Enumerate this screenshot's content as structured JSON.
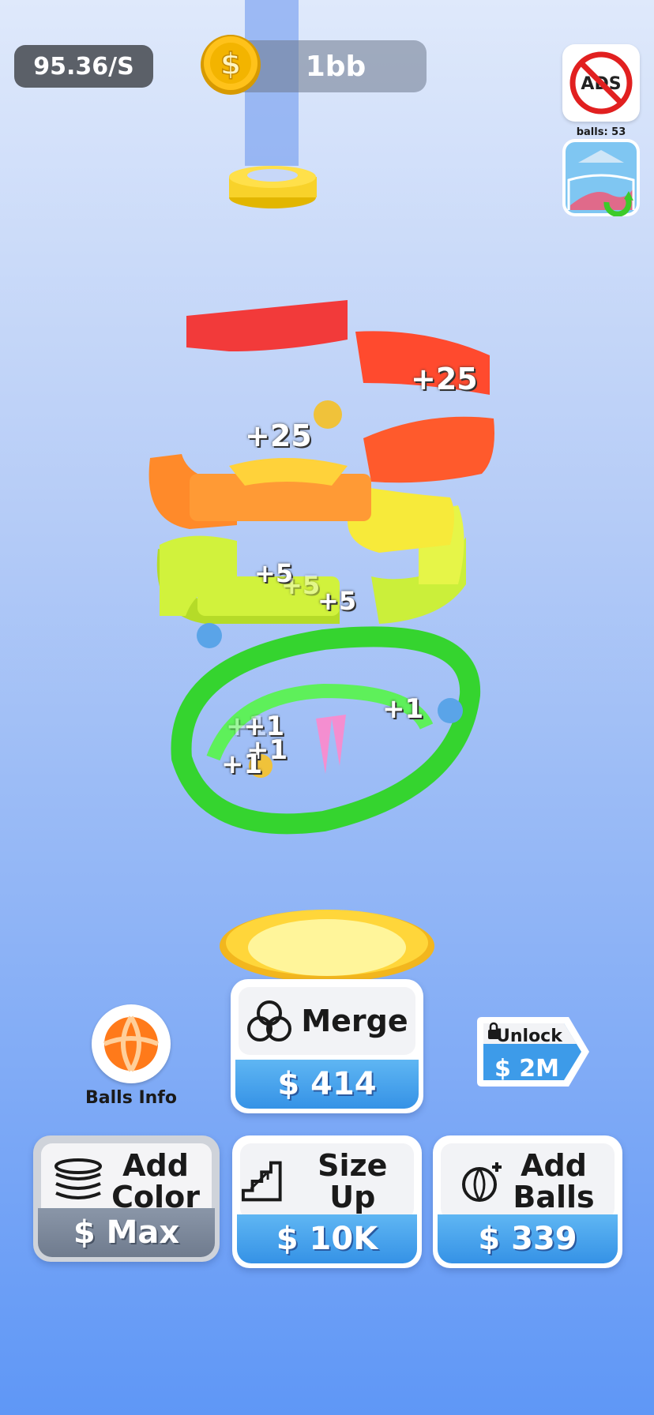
{
  "hud": {
    "rate": "95.36/S",
    "coins": "1bb",
    "ads_label": "ADS",
    "balls_count": "balls: 53"
  },
  "scores": [
    "+25",
    "+25",
    "+5",
    "+5",
    "+5",
    "+1",
    "+1",
    "+1",
    "+1",
    "+1"
  ],
  "balls_info": {
    "label": "Balls Info"
  },
  "unlock": {
    "label": "Unlock",
    "price": "$ 2M"
  },
  "merge": {
    "label": "Merge",
    "price": "$ 414"
  },
  "add_color": {
    "label_line1": "Add",
    "label_line2": "Color",
    "price": "$ Max"
  },
  "size_up": {
    "label": "Size Up",
    "price": "$ 10K"
  },
  "add_balls": {
    "label_line1": "Add",
    "label_line2": "Balls",
    "price": "$ 339"
  },
  "colors": {
    "red": "#f23a3a",
    "orange_red": "#ff5a2c",
    "orange": "#ff8a2a",
    "yellow": "#f7ea3a",
    "lime": "#cdf03a",
    "green": "#3fe63a",
    "price_blue": "#3592e6",
    "coin_gold": "#f3b400"
  }
}
